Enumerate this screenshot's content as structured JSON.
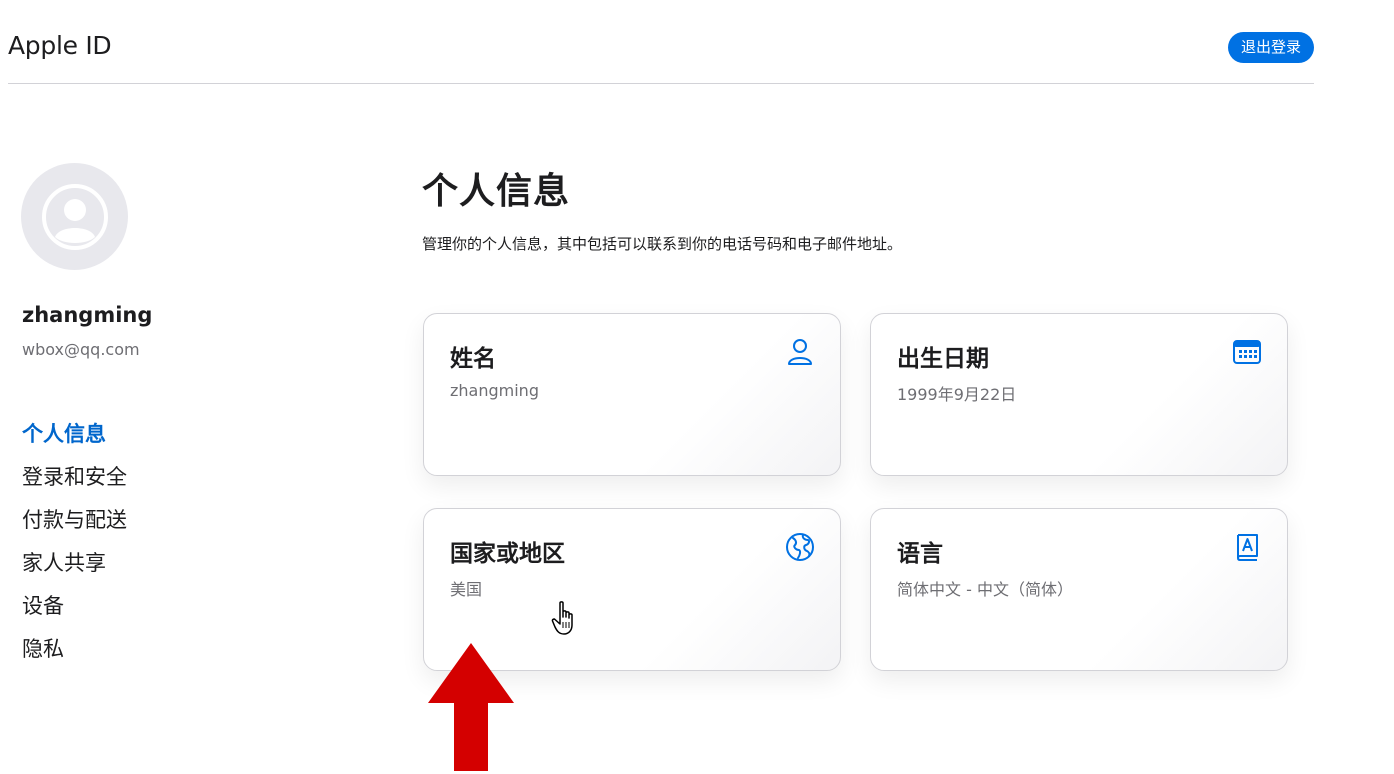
{
  "header": {
    "title": "Apple ID",
    "signout_label": "退出登录"
  },
  "user": {
    "name": "zhangming",
    "email": "wbox@qq.com"
  },
  "sidebar": {
    "items": [
      {
        "label": "个人信息",
        "active": true
      },
      {
        "label": "登录和安全"
      },
      {
        "label": "付款与配送"
      },
      {
        "label": "家人共享"
      },
      {
        "label": "设备"
      },
      {
        "label": "隐私"
      }
    ]
  },
  "main": {
    "title": "个人信息",
    "description": "管理你的个人信息，其中包括可以联系到你的电话号码和电子邮件地址。",
    "cards": [
      {
        "title": "姓名",
        "value": "zhangming",
        "icon": "person-icon"
      },
      {
        "title": "出生日期",
        "value": "1999年9月22日",
        "icon": "calendar-icon"
      },
      {
        "title": "国家或地区",
        "value": "美国",
        "icon": "globe-icon"
      },
      {
        "title": "语言",
        "value": "简体中文 - 中文（简体）",
        "icon": "dictionary-icon"
      }
    ]
  },
  "colors": {
    "accent": "#0071e3",
    "link": "#0066cc",
    "annotation_arrow": "#d40000"
  }
}
